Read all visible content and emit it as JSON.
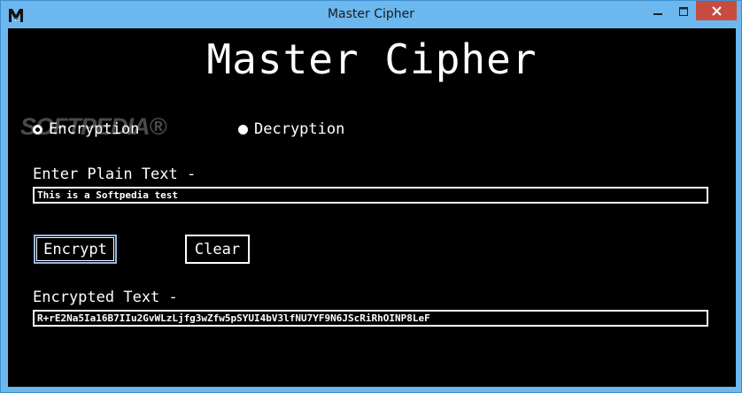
{
  "window": {
    "title": "Master Cipher",
    "icons": {
      "app": "app-logo-icon",
      "minimize": "minimize-icon",
      "maximize": "maximize-icon",
      "close": "close-icon"
    }
  },
  "main": {
    "heading": "Master Cipher",
    "watermark": "SOFTPEDIA®",
    "mode": {
      "encryption_label": "Encryption",
      "decryption_label": "Decryption",
      "selected": "Encryption"
    },
    "plain_text_label": "Enter Plain Text -",
    "plain_text_value": "This is a Softpedia test",
    "encrypt_label": "Encrypt",
    "clear_label": "Clear",
    "encrypted_text_label": "Encrypted Text -",
    "encrypted_text_value": "R+rE2Na5Ia16B7IIu2GvWLzLjfg3wZfw5pSYUI4bV3lfNU7YF9N6JScRiRhOINP8LeF"
  }
}
